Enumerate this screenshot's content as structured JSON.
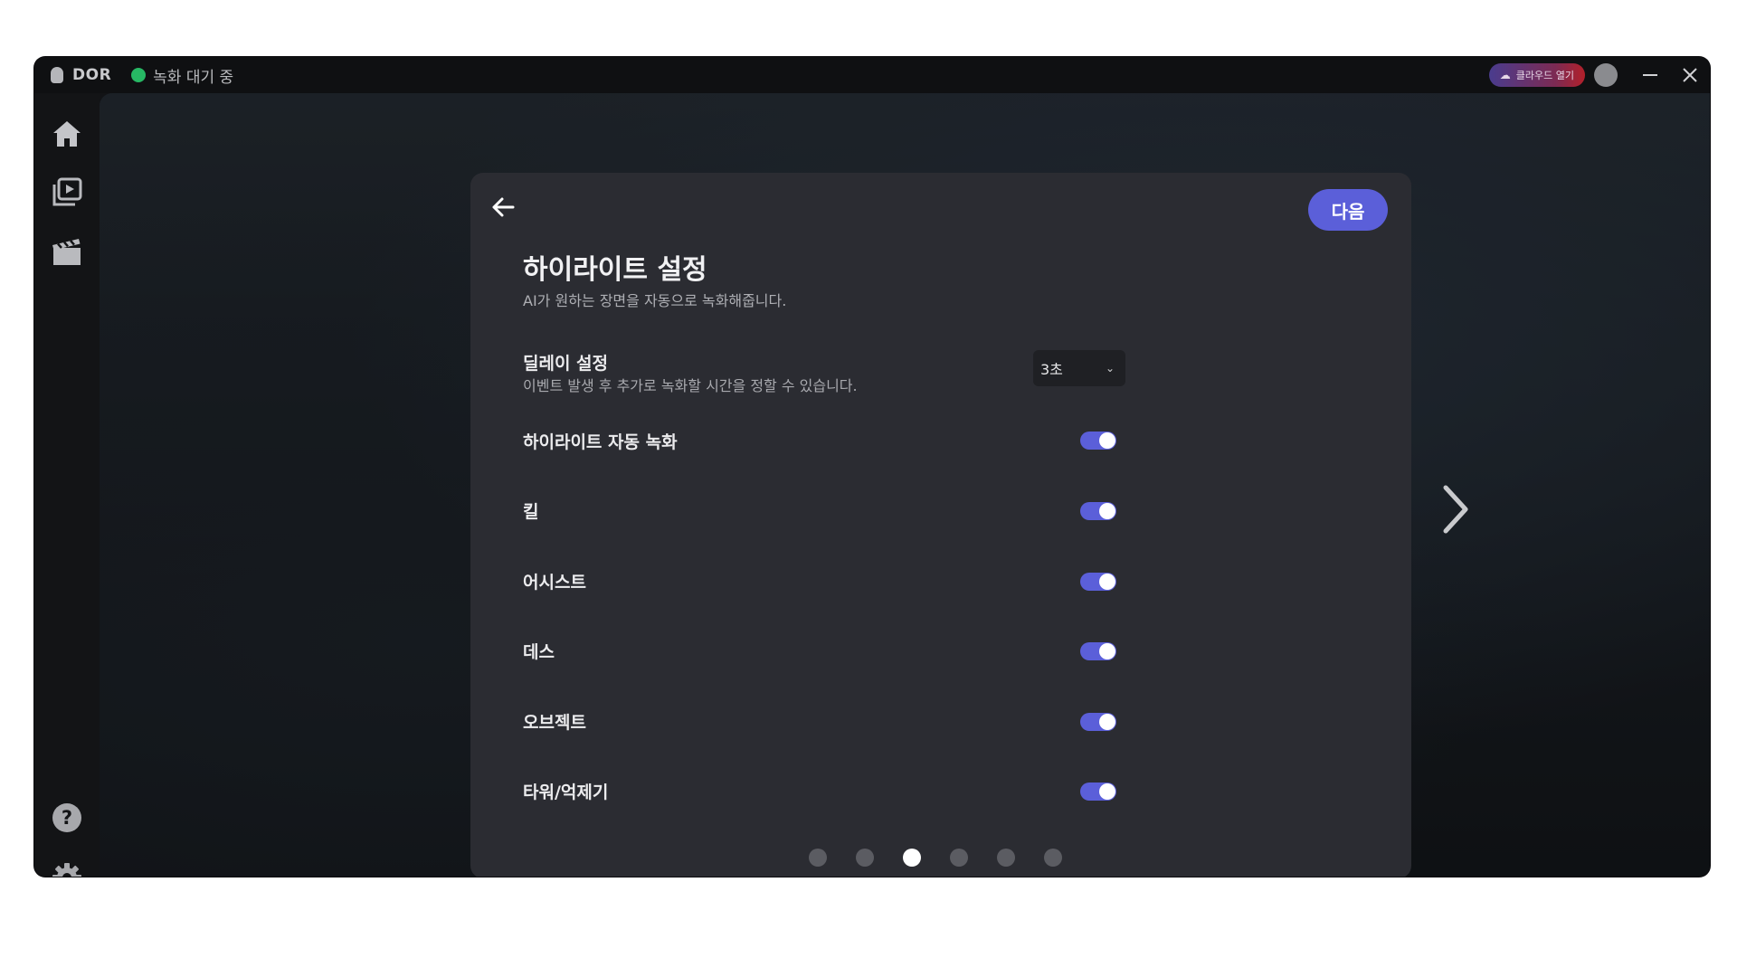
{
  "titlebar": {
    "app_name": "DOR",
    "status_text": "녹화 대기 중",
    "status_color": "#27b864",
    "cloud_button_label": "클라우드 열기",
    "cloud_icon": "cloud-icon"
  },
  "sidebar": {
    "items": [
      {
        "icon": "home-icon"
      },
      {
        "icon": "video-library-icon"
      },
      {
        "icon": "clapperboard-icon"
      }
    ],
    "bottom_items": [
      {
        "icon": "help-icon"
      },
      {
        "icon": "gear-icon"
      }
    ]
  },
  "panel": {
    "back_icon": "arrow-left-icon",
    "next_label": "다음",
    "title": "하이라이트 설정",
    "subtitle": "AI가 원하는 장면을 자동으로 녹화해줍니다.",
    "delay": {
      "label": "딜레이 설정",
      "description": "이벤트 발생 후 추가로 녹화할 시간을 정할 수 있습니다.",
      "selected_value": "3초"
    },
    "toggles": [
      {
        "label": "하이라이트 자동 녹화",
        "on": true
      },
      {
        "label": "킬",
        "on": true
      },
      {
        "label": "어시스트",
        "on": true
      },
      {
        "label": "데스",
        "on": true
      },
      {
        "label": "오브젝트",
        "on": true
      },
      {
        "label": "타워/억제기",
        "on": true
      }
    ],
    "pagination": {
      "total": 6,
      "current": 3
    }
  },
  "colors": {
    "accent": "#5b5fd9",
    "panel_bg": "#2b2c32"
  }
}
